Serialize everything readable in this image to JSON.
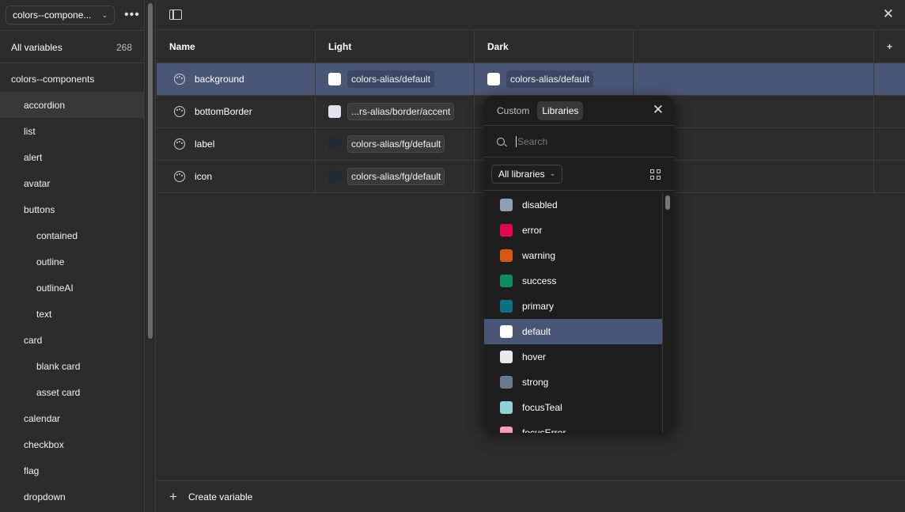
{
  "sidebar": {
    "collection": "colors--compone...",
    "all_variables_label": "All variables",
    "all_variables_count": "268",
    "items": [
      {
        "label": "colors--components",
        "level": 0
      },
      {
        "label": "accordion",
        "level": 1,
        "active": true
      },
      {
        "label": "list",
        "level": 1
      },
      {
        "label": "alert",
        "level": 1
      },
      {
        "label": "avatar",
        "level": 1
      },
      {
        "label": "buttons",
        "level": 1
      },
      {
        "label": "contained",
        "level": 2
      },
      {
        "label": "outline",
        "level": 2
      },
      {
        "label": "outlineAI",
        "level": 2
      },
      {
        "label": "text",
        "level": 2
      },
      {
        "label": "card",
        "level": 1
      },
      {
        "label": "blank card",
        "level": 2
      },
      {
        "label": "asset card",
        "level": 2
      },
      {
        "label": "calendar",
        "level": 1
      },
      {
        "label": "checkbox",
        "level": 1
      },
      {
        "label": "flag",
        "level": 1
      },
      {
        "label": "dropdown",
        "level": 1
      }
    ]
  },
  "table": {
    "headers": {
      "name": "Name",
      "light": "Light",
      "dark": "Dark"
    },
    "rows": [
      {
        "name": "background",
        "light": {
          "value": "colors-alias/default",
          "color": "#ffffff"
        },
        "dark": {
          "value": "colors-alias/default",
          "color": "#ffffff"
        },
        "selected": true
      },
      {
        "name": "bottomBorder",
        "light": {
          "value": "...rs-alias/border/accent",
          "color": "#dfe3ea"
        },
        "dark": null
      },
      {
        "name": "label",
        "light": {
          "value": "colors-alias/fg/default",
          "color": "#232a33"
        },
        "dark": null
      },
      {
        "name": "icon",
        "light": {
          "value": "colors-alias/fg/default",
          "color": "#232a33"
        },
        "dark": null
      }
    ]
  },
  "footer": {
    "create_label": "Create variable"
  },
  "popover": {
    "tabs": [
      "Custom",
      "Libraries"
    ],
    "active_tab": "Libraries",
    "search_placeholder": "Search",
    "library_filter": "All libraries",
    "items": [
      {
        "label": "disabled",
        "color": "#8f9fb3"
      },
      {
        "label": "error",
        "color": "#e0094a"
      },
      {
        "label": "warning",
        "color": "#d45713"
      },
      {
        "label": "success",
        "color": "#0e8a68"
      },
      {
        "label": "primary",
        "color": "#0c7282"
      },
      {
        "label": "default",
        "color": "#ffffff",
        "highlight": true
      },
      {
        "label": "hover",
        "color": "#e6e9ee"
      },
      {
        "label": "strong",
        "color": "#6a7a8e"
      },
      {
        "label": "focusTeal",
        "color": "#8fd0d3"
      },
      {
        "label": "focusError",
        "color": "#f59ab8"
      }
    ]
  },
  "colors": {
    "selection": "#4a5675",
    "background": "#2c2c2c",
    "popover_bg": "#1e1e1e"
  }
}
